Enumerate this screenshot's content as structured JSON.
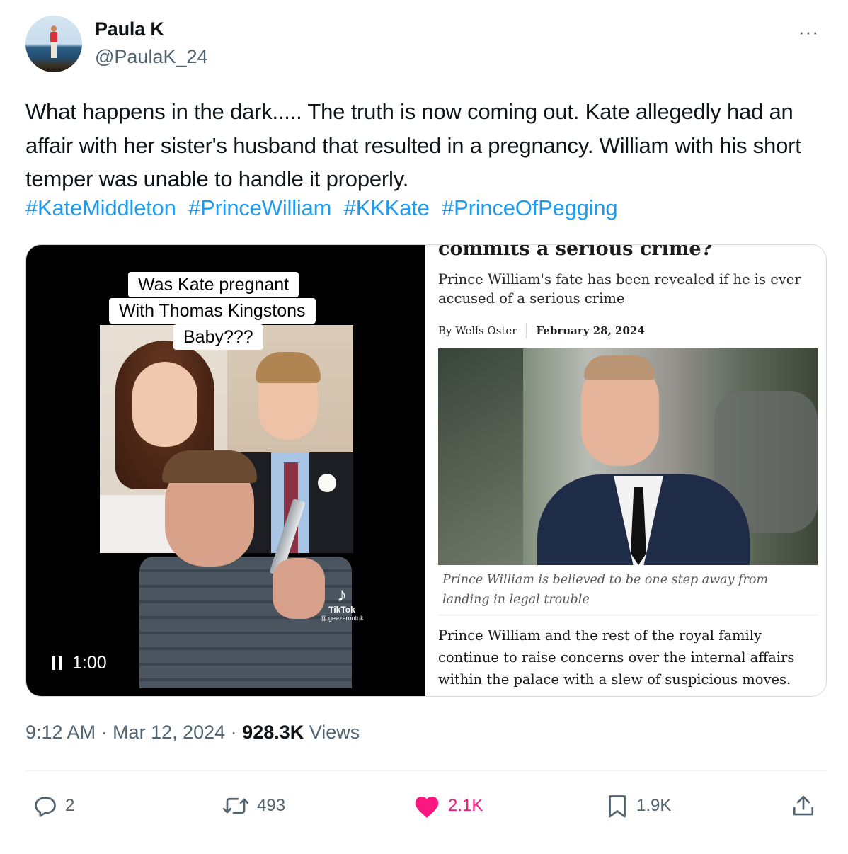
{
  "author": {
    "name": "Paula K",
    "handle": "@PaulaK_24"
  },
  "menu": {
    "more_label": "···"
  },
  "tweet": {
    "text": "What happens in the dark..... The truth is now coming out. Kate allegedly had an affair with her sister's husband that resulted in a pregnancy. William with his short temper was unable to handle it properly.",
    "hashtags": [
      "#KateMiddleton",
      "#PrinceWilliam",
      "#KKKate",
      "#PrinceOfPegging"
    ]
  },
  "video": {
    "caption_lines": [
      "Was Kate pregnant",
      "With Thomas Kingstons",
      "Baby???"
    ],
    "watermark_app": "TikTok",
    "watermark_user": "@ geezerontok",
    "duration": "1:00"
  },
  "article": {
    "headline": "commits a serious crime?",
    "subheading": "Prince William's fate has been revealed if he is ever accused of a serious crime",
    "byline_author": "By Wells Oster",
    "byline_date": "February 28, 2024",
    "photo_caption": "Prince William is believed to be one step away from landing in legal trouble",
    "body": "Prince William and the rest of the royal family continue to raise concerns over the internal affairs within the palace with a slew of suspicious moves."
  },
  "meta": {
    "time": "9:12 AM",
    "sep1": " · ",
    "date": "Mar 12, 2024",
    "sep2": " · ",
    "views_count": "928.3K",
    "views_label": " Views"
  },
  "actions": {
    "replies": "2",
    "reposts": "493",
    "likes": "2.1K",
    "bookmarks": "1.9K"
  },
  "colors": {
    "link": "#1d9bf0",
    "like": "#f91880",
    "secondary_text": "#536471"
  }
}
